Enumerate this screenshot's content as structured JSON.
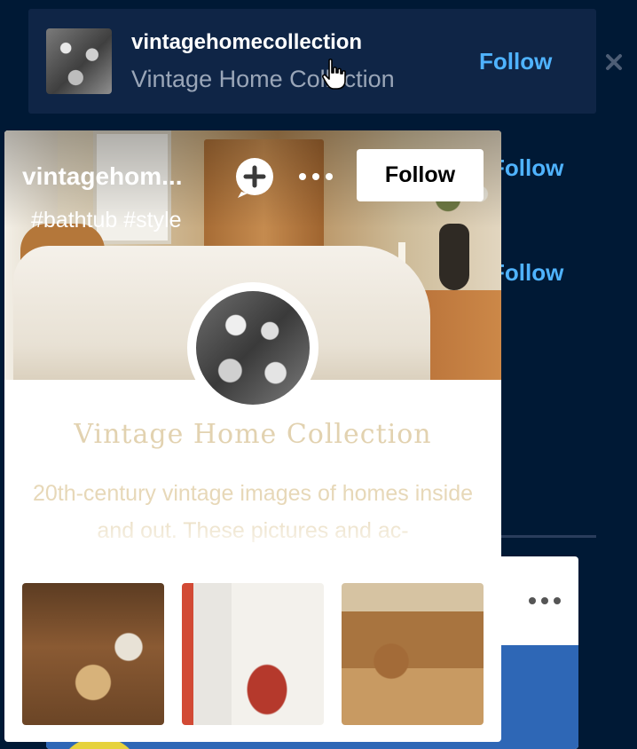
{
  "suggestion_card": {
    "username": "vintagehomecollection",
    "title": "Vintage Home Collection",
    "follow_label": "Follow"
  },
  "background_follow": [
    "Follow",
    "Follow"
  ],
  "popover": {
    "username": "vintagehom...",
    "tags": "#bathtub #style",
    "follow_label": "Follow",
    "blog_title": "Vintage Home Collection",
    "description": "20th-century vintage images of homes inside and out. These pictures and ac-",
    "thumbnails": [
      "kitchen",
      "bedroom",
      "study"
    ]
  },
  "icons": {
    "add": "plus-circle-icon",
    "more": "more-dots-icon",
    "dismiss": "close-icon",
    "cursor": "hand-pointer-icon"
  },
  "colors": {
    "background": "#001935",
    "card": "#0f2546",
    "accent_link": "#4fb3ff",
    "title_tan": "#e2d2b0"
  }
}
